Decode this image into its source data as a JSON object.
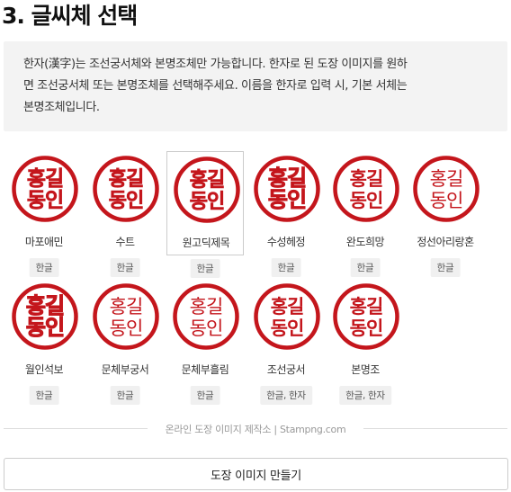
{
  "section": {
    "title": "3. 글씨체 선택",
    "notice": "한자(漢字)는 조선궁서체와 본명조체만 가능합니다. 한자로 된 도장 이미지를 원하\n면 조선궁서체 또는 본명조체를 선택해주세요. 이름을 한자로 입력 시, 기본 서체는\n본명조체입니다."
  },
  "stamp_text": {
    "line1": "홍길",
    "line2": "동인"
  },
  "colors": {
    "stamp": "#c4161c",
    "accent_border": "#cccccc"
  },
  "fonts": [
    {
      "name": "마포애민",
      "tag": "한글",
      "selected": false,
      "style": "bold-serif"
    },
    {
      "name": "수트",
      "tag": "한글",
      "selected": false,
      "style": "bold-sans"
    },
    {
      "name": "원고딕제목",
      "tag": "한글",
      "selected": true,
      "style": "bold-sans"
    },
    {
      "name": "수성헤정",
      "tag": "한글",
      "selected": false,
      "style": "brush"
    },
    {
      "name": "완도희망",
      "tag": "한글",
      "selected": false,
      "style": "round"
    },
    {
      "name": "정선아리랑혼",
      "tag": "한글",
      "selected": false,
      "style": "light"
    },
    {
      "name": "월인석보",
      "tag": "한글",
      "selected": false,
      "style": "heavy"
    },
    {
      "name": "문체부궁서",
      "tag": "한글",
      "selected": false,
      "style": "thin"
    },
    {
      "name": "문체부흘림",
      "tag": "한글",
      "selected": false,
      "style": "thin"
    },
    {
      "name": "조선궁서",
      "tag": "한글, 한자",
      "selected": false,
      "style": "serif"
    },
    {
      "name": "본명조",
      "tag": "한글, 한자",
      "selected": false,
      "style": "serif"
    }
  ],
  "footer": {
    "credit": "온라인 도장 이미지 제작소 | Stampng.com",
    "make_button": "도장 이미지 만들기"
  }
}
